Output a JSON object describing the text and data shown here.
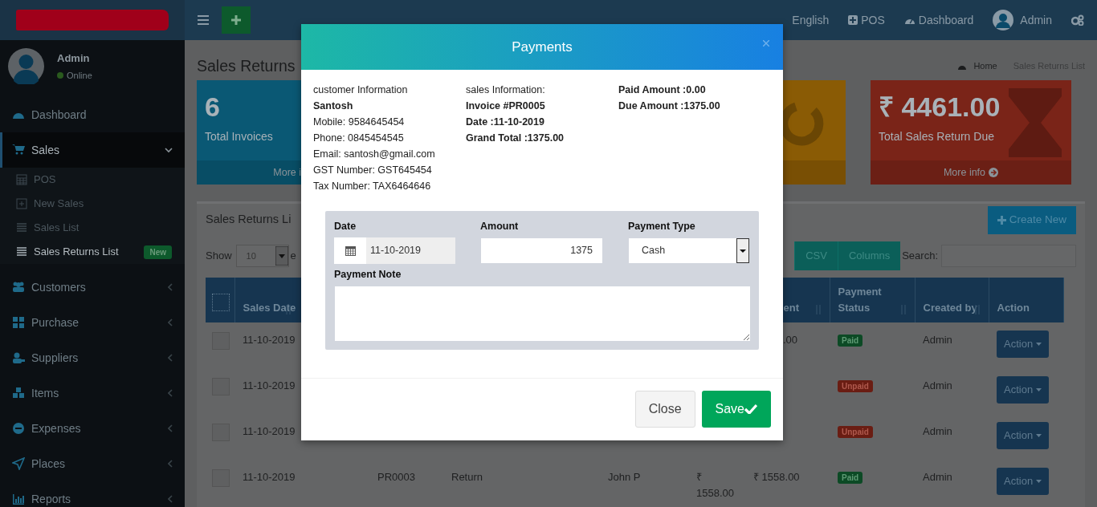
{
  "header": {
    "language": "English",
    "pos": "POS",
    "dashboard": "Dashboard",
    "user": "Admin"
  },
  "sidebar": {
    "user": {
      "name": "Admin",
      "status": "Online"
    },
    "items": [
      {
        "label": "Dashboard",
        "kind": "link",
        "selected": false
      },
      {
        "label": "Sales",
        "kind": "tree",
        "expanded": true,
        "selected": true,
        "children": [
          {
            "label": "POS",
            "selected": false
          },
          {
            "label": "New Sales",
            "selected": false
          },
          {
            "label": "Sales List",
            "selected": false
          },
          {
            "label": "Sales Returns List",
            "selected": true,
            "badge": "New"
          }
        ]
      },
      {
        "label": "Customers",
        "kind": "tree",
        "expanded": false,
        "selected": false
      },
      {
        "label": "Purchase",
        "kind": "tree",
        "expanded": false,
        "selected": false
      },
      {
        "label": "Suppliers",
        "kind": "tree",
        "expanded": false,
        "selected": false
      },
      {
        "label": "Items",
        "kind": "tree",
        "expanded": false,
        "selected": false
      },
      {
        "label": "Expenses",
        "kind": "tree",
        "expanded": false,
        "selected": false
      },
      {
        "label": "Places",
        "kind": "tree",
        "expanded": false,
        "selected": false
      },
      {
        "label": "Reports",
        "kind": "tree",
        "expanded": false,
        "selected": false
      }
    ]
  },
  "page": {
    "title": "Sales Returns",
    "breadcrumb": [
      "Home",
      "Sales Returns List"
    ]
  },
  "info_boxes": [
    {
      "kind": "blue",
      "value": "6",
      "label": "Total Invoices",
      "footer": "More i"
    },
    {
      "kind": "orange"
    },
    {
      "kind": "red",
      "value": "₹ 4461.00",
      "label": "Total Sales Return Due",
      "footer": "More info"
    }
  ],
  "panel": {
    "title": "Sales Returns Li",
    "create_button": "Create New",
    "show_label": "Show",
    "page_size": "10",
    "entries_label": "e",
    "buttons": [
      "CSV",
      "Columns"
    ],
    "search_label": "Search:"
  },
  "table": {
    "select_all_checked": false,
    "headers": {
      "sales_date": "Sales Date",
      "column_7": "ent",
      "payment_status": "Payment Status",
      "created_by": "Created by",
      "action": "Action"
    },
    "rows": [
      {
        "checked": false,
        "sales_date": "11-10-2019",
        "column_7": ".00",
        "payment_status": {
          "text": "Paid",
          "kind": "paid"
        },
        "created_by": "Admin",
        "action": "Action"
      },
      {
        "checked": false,
        "sales_date": "11-10-2019",
        "payment_status": {
          "text": "Unpaid",
          "kind": "unpaid"
        },
        "created_by": "Admin",
        "action": "Action"
      },
      {
        "checked": false,
        "sales_date": "11-10-2019",
        "payment_status": {
          "text": "Unpaid",
          "kind": "unpaid"
        },
        "created_by": "Admin",
        "action": "Action"
      },
      {
        "checked": false,
        "sales_date": "11-10-2019",
        "column_3": "PR0003",
        "column_4": "Return",
        "column_5": "John P",
        "column_6": "₹ 1558.00",
        "column_7": "₹ 1558.00",
        "payment_status": {
          "text": "Paid",
          "kind": "paid"
        },
        "created_by": "Admin",
        "action": "Action"
      }
    ]
  },
  "modal": {
    "title": "Payments",
    "customer": [
      "customer Information",
      "Santosh",
      "Mobile: 9584645454",
      "Phone: 0845454545",
      "Email: santosh@gmail.com",
      "GST Number: GST645454",
      "Tax Number: TAX6464646"
    ],
    "sales": [
      "sales Information:",
      "Invoice #PR0005",
      "Date :11-10-2019",
      "Grand Total :1375.00"
    ],
    "amounts": [
      "Paid Amount :0.00",
      "Due Amount :1375.00"
    ],
    "form": {
      "date_label": "Date",
      "date": "11-10-2019",
      "amount_label": "Amount",
      "amount": "1375",
      "type_label": "Payment Type",
      "type": "Cash",
      "note_label": "Payment Note"
    },
    "buttons": {
      "close": "Close",
      "save": "Save"
    }
  }
}
